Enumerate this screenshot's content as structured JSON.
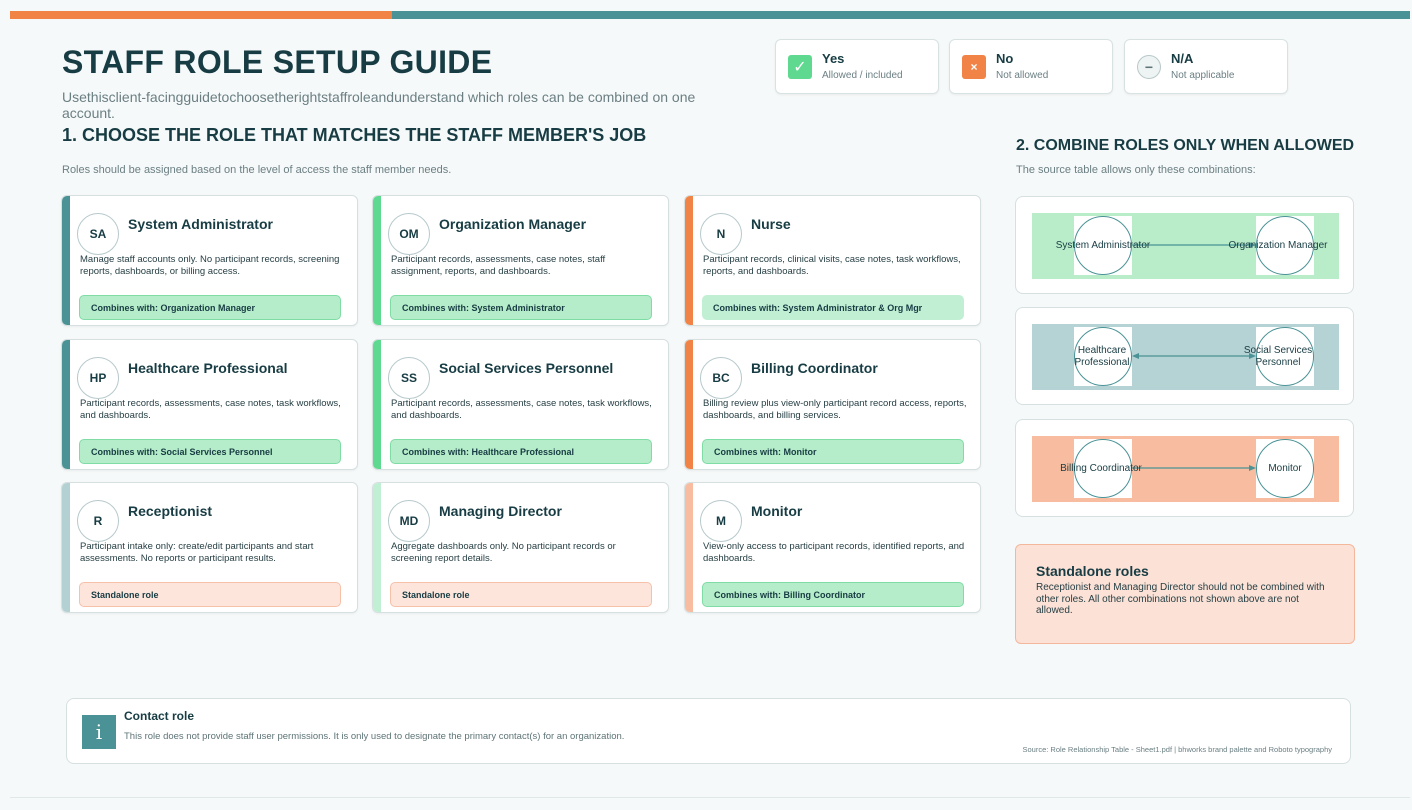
{
  "title": "STAFF ROLE SETUP GUIDE",
  "subtitle": "Usethisclient-facingguidetochoosetherightstaffroleandunderstand which roles can be combined on one account.",
  "legend": [
    {
      "symbol": "✓",
      "label": "Yes",
      "note": "Allowed / included",
      "color": "#5fd890"
    },
    {
      "symbol": "×",
      "label": "No",
      "note": "Not allowed",
      "color": "#f08345"
    },
    {
      "symbol": "−",
      "label": "N/A",
      "note": "Not applicable",
      "color": "#eef3f3"
    }
  ],
  "section1": {
    "heading": "1. CHOOSE THE ROLE THAT MATCHES THE STAFF MEMBER'S JOB",
    "note": "Roles should be assigned based on the level of access the staff member needs."
  },
  "section2": {
    "heading": "2. COMBINE ROLES ONLY WHEN ALLOWED",
    "note": "The source table allows only these combinations:"
  },
  "roles": [
    {
      "initials": "SA",
      "name": "System Administrator",
      "desc": "Manage staff accounts only. No participant records, screening reports, dashboards, or billing access.",
      "combo": "Combines with: Organization Manager",
      "stripe": "#4a9295",
      "combo_style": "green"
    },
    {
      "initials": "OM",
      "name": "Organization Manager",
      "desc": "Participant records, assessments, case notes, staff assignment, reports, and dashboards.",
      "combo": "Combines with: System Administrator",
      "stripe": "#5fd890",
      "combo_style": "green"
    },
    {
      "initials": "N",
      "name": "Nurse",
      "desc": "Participant records, clinical visits, case notes, task workflows, reports, and dashboards.",
      "combo": "Combines with: System Administrator & Org Mgr",
      "stripe": "#f08345",
      "combo_style": "greenflat"
    },
    {
      "initials": "HP",
      "name": "Healthcare Professional",
      "desc": "Participant records, assessments, case notes, task workflows, and dashboards.",
      "combo": "Combines with: Social Services Personnel",
      "stripe": "#4a9295",
      "combo_style": "green"
    },
    {
      "initials": "SS",
      "name": "Social Services Personnel",
      "desc": "Participant records, assessments, case notes, task workflows, and dashboards.",
      "combo": "Combines with: Healthcare Professional",
      "stripe": "#5fd890",
      "combo_style": "green"
    },
    {
      "initials": "BC",
      "name": "Billing Coordinator",
      "desc": "Billing review plus view-only participant record access, reports, dashboards, and billing services.",
      "combo": "Combines with: Monitor",
      "stripe": "#f08345",
      "combo_style": "green"
    },
    {
      "initials": "R",
      "name": "Receptionist",
      "desc": "Participant intake only: create/edit participants and start assessments. No reports or participant results.",
      "combo": "Standalone role",
      "stripe": "#b3d0d2",
      "combo_style": "peach"
    },
    {
      "initials": "MD",
      "name": "Managing Director",
      "desc": "Aggregate dashboards only. No participant records or screening report details.",
      "combo": "Standalone role",
      "stripe": "#c1efd4",
      "combo_style": "peach"
    },
    {
      "initials": "M",
      "name": "Monitor",
      "desc": "View-only access to participant records, identified reports, and dashboards.",
      "combo": "Combines with: Billing Coordinator",
      "stripe": "#f8bca0",
      "combo_style": "green"
    }
  ],
  "combinations": [
    {
      "left": "System Administrator",
      "right": "Organization Manager",
      "band_color": "#b9ecc9",
      "arrows": "single"
    },
    {
      "left": "Healthcare\nProfessional",
      "right": "Social Services\nPersonnel",
      "band_color": "#b5d2d5",
      "arrows": "double"
    },
    {
      "left": "Billing Coordinator",
      "right": "Monitor",
      "band_color": "#f8bda0",
      "arrows": "single-end"
    }
  ],
  "standalone": {
    "heading": "Standalone roles",
    "body": "Receptionist and Managing Director should not be combined with other roles. All other combinations not shown above are not allowed."
  },
  "contact": {
    "icon": "i",
    "heading": "Contact role",
    "body": "This role does not provide staff user permissions. It is only used to designate the primary contact(s) for an organization.",
    "source": "Source: Role Relationship Table - Sheet1.pdf | bhworks brand palette and Roboto typography"
  }
}
